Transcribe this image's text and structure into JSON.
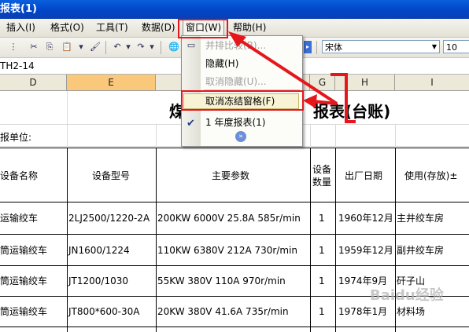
{
  "window": {
    "title": "报表(1)"
  },
  "menubar": {
    "items": [
      {
        "label": "插入(I)"
      },
      {
        "label": "格式(O)"
      },
      {
        "label": "工具(T)"
      },
      {
        "label": "数据(D)"
      },
      {
        "label": "窗口(W)"
      },
      {
        "label": "帮助(H)"
      }
    ]
  },
  "toolbar": {
    "font_name": "宋体",
    "font_size": "10"
  },
  "formula_bar": {
    "name_box": "TH2-14"
  },
  "columns": [
    "D",
    "E",
    "G",
    "H",
    "I"
  ],
  "window_menu": {
    "items": [
      {
        "label": "并排比较(B)...",
        "enabled": false
      },
      {
        "label": "隐藏(H)",
        "enabled": true
      },
      {
        "label": "取消隐藏(U)...",
        "enabled": false
      },
      {
        "label": "取消冻结窗格(F)",
        "enabled": true
      },
      {
        "label": "1 年度报表(1)",
        "enabled": true,
        "checked": true
      }
    ],
    "expand_icon": "double-chevron-down-icon"
  },
  "sheet": {
    "title_left": "煤",
    "title_right": "报表(台账)",
    "unit_label": "报单位:",
    "headers": {
      "name": "设备名称",
      "model": "设备型号",
      "params": "主要参数",
      "qty_line1": "设备",
      "qty_line2": "数量",
      "date": "出厂日期",
      "use": "使用(存放)±"
    },
    "rows": [
      {
        "name": "运输绞车",
        "model": "2LJ2500/1220-2A",
        "params": "200KW  6000V 25.8A 585r/min",
        "qty": "1",
        "date": "1960年12月",
        "use": "主井绞车房"
      },
      {
        "name": "筒运输绞车",
        "model": "JN1600/1224",
        "params": "110KW  6380V 212A 730r/min",
        "qty": "1",
        "date": "1959年12月",
        "use": "副井绞车房"
      },
      {
        "name": "筒运输绞车",
        "model": "JT1200/1030",
        "params": "55KW  380V  110A  970r/min",
        "qty": "1",
        "date": "1974年9月",
        "use": "矸子山"
      },
      {
        "name": "筒运输绞车",
        "model": "JT800*600-30A",
        "params": "20KW  380V  41.6A  735r/min",
        "qty": "1",
        "date": "1978年1月",
        "use": "材料场"
      }
    ]
  },
  "watermark": "Baidu经验",
  "colors": {
    "annotation": "#e5171c",
    "selected_column": "#f9c87a",
    "titlebar": "#0046c8"
  }
}
